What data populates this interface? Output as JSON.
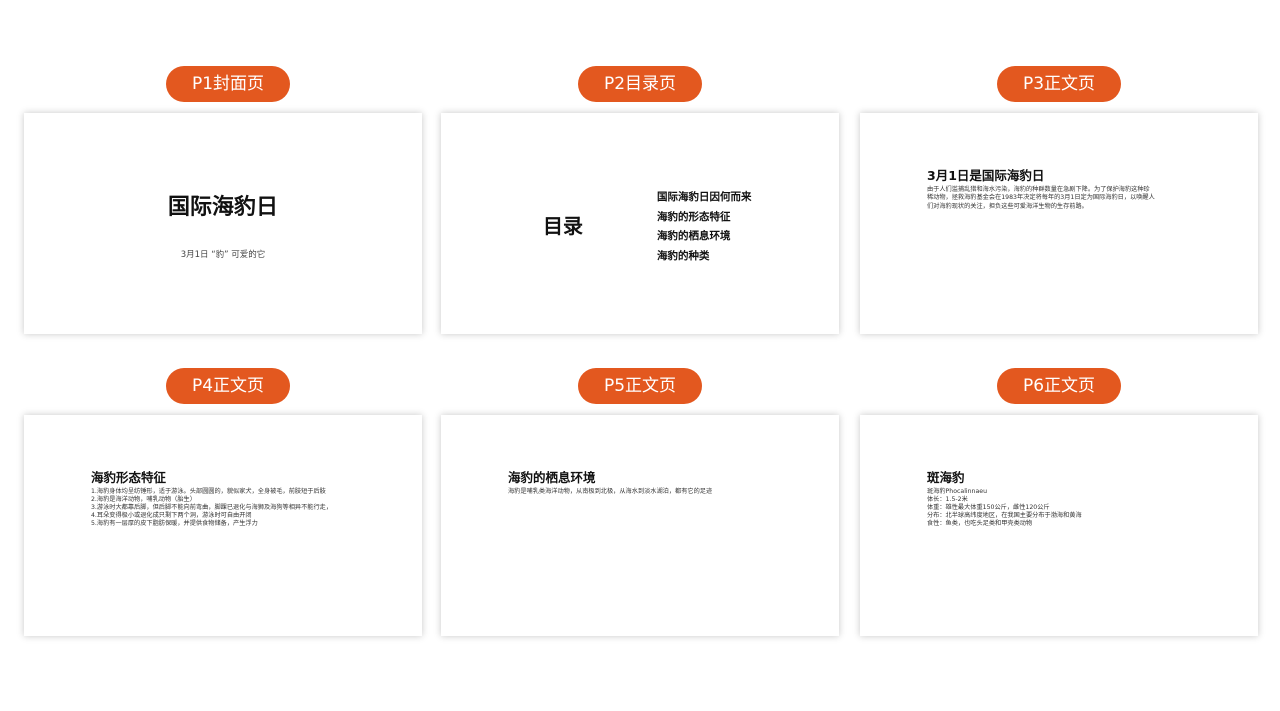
{
  "theme": {
    "accent": "#E3581F",
    "card_bg": "#FFFFFF",
    "text": "#1A1A1A"
  },
  "slides": [
    {
      "label": "P1封面页",
      "title": "国际海豹日",
      "subtitle": "3月1日 “豹” 可爱的它"
    },
    {
      "label": "P2目录页",
      "title": "目录",
      "toc": [
        "国际海豹日因何而来",
        "海豹的形态特征",
        "海豹的栖息环境",
        "海豹的种类"
      ]
    },
    {
      "label": "P3正文页",
      "title": "3月1日是国际海豹日",
      "body": "由于人们滥捕乱猎和海水污染，海豹的种群数量在急剧下降。为了保护海豹这种珍稀动物，拯救海豹基金会在1983年决定将每年的3月1日定为国际海豹日，以唤醒人们对海豹现状的关注，担负这些可爱海洋生物的生存前路。"
    },
    {
      "label": "P4正文页",
      "title": "海豹形态特征",
      "lines": [
        "1.海豹身体均呈纺锤形，适于游泳。头部圆圆的，貌似家犬，全身被毛，前肢短于后肢",
        "2.海豹是海洋动物，哺乳动物（胎生）",
        "3.游泳时大都靠后脚，但后脚不能向前弯曲，脚踝已退化与海狮及海狗等相异不能行走，",
        "4.耳朵变得极小或退化成只剩下两个洞，游泳时可自由开闭",
        "5.海豹有一层厚的皮下脂肪保暖，并提供食物储备，产生浮力"
      ]
    },
    {
      "label": "P5正文页",
      "title": "海豹的栖息环境",
      "body": "海豹是哺乳类海洋动物，从南极到北极，从海水到淡水湖泊，都有它的足迹"
    },
    {
      "label": "P6正文页",
      "title": "斑海豹",
      "lines": [
        "斑海豹Phocalinnaeu",
        "体长：1.5-2米",
        "体重：雄性最大体重150公斤，雌性120公斤",
        "分布：北半球高纬度地区，在我国主要分布于渤海和黄海",
        "食性：鱼类，也吃头足类和甲壳类动物"
      ]
    }
  ]
}
